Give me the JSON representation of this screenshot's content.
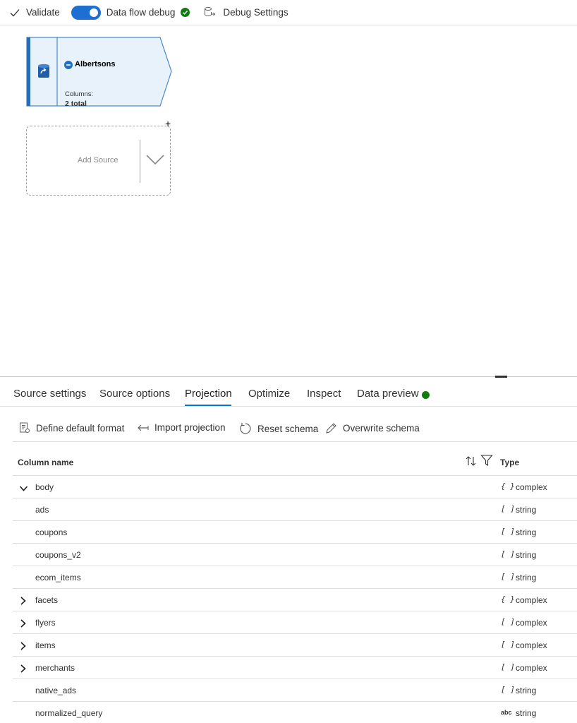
{
  "toolbar": {
    "validate_label": "Validate",
    "debug_label": "Data flow debug",
    "debug_settings_label": "Debug Settings"
  },
  "canvas": {
    "source_node": {
      "title": "Albertsons",
      "columns_label": "Columns:",
      "columns_value": "2 total",
      "add_symbol": "+"
    },
    "add_source_label": "Add Source"
  },
  "tabs": [
    {
      "label": "Source settings"
    },
    {
      "label": "Source options"
    },
    {
      "label": "Projection"
    },
    {
      "label": "Optimize"
    },
    {
      "label": "Inspect"
    },
    {
      "label": "Data preview"
    }
  ],
  "actions": {
    "define_default_format": "Define default format",
    "import_projection": "Import projection",
    "reset_schema": "Reset schema",
    "overwrite_schema": "Overwrite schema"
  },
  "table": {
    "header_name": "Column name",
    "header_type": "Type",
    "rows": [
      {
        "name": "body",
        "type_icon": "{ }",
        "type": "complex"
      },
      {
        "name": "ads",
        "type_icon": "[ ]",
        "type": "string"
      },
      {
        "name": "coupons",
        "type_icon": "[ ]",
        "type": "string"
      },
      {
        "name": "coupons_v2",
        "type_icon": "[ ]",
        "type": "string"
      },
      {
        "name": "ecom_items",
        "type_icon": "[ ]",
        "type": "string"
      },
      {
        "name": "facets",
        "type_icon": "{ }",
        "type": "complex"
      },
      {
        "name": "flyers",
        "type_icon": "[ ]",
        "type": "complex"
      },
      {
        "name": "items",
        "type_icon": "[ ]",
        "type": "complex"
      },
      {
        "name": "merchants",
        "type_icon": "[ ]",
        "type": "complex"
      },
      {
        "name": "native_ads",
        "type_icon": "[ ]",
        "type": "string"
      },
      {
        "name": "normalized_query",
        "type_icon": "abc",
        "type": "string"
      }
    ]
  },
  "colors": {
    "accent": "#0078d4",
    "toggle_on": "#1d6fd1",
    "node_border": "#4a89c8",
    "node_fill": "#e8f2fb",
    "status_ok": "#107c10"
  }
}
